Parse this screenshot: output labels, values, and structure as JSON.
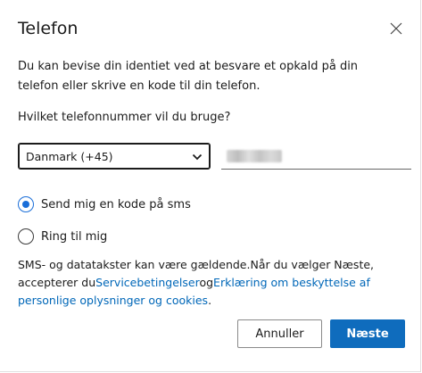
{
  "dialog": {
    "title": "Telefon",
    "close_icon": "close-icon",
    "description": "Du kan bevise din identiet ved at besvare et opkald på din telefon eller skrive en kode til din telefon.",
    "question": "Hvilket telefonnummer vil du bruge?",
    "country_select": {
      "selected": "Danmark (+45)"
    },
    "phone_input": {
      "value_obscured": true
    },
    "options": [
      {
        "label": "Send mig en kode på sms",
        "selected": true
      },
      {
        "label": "Ring til mig",
        "selected": false
      }
    ],
    "legal": {
      "text1": "SMS- og datatakster kan være gældende.Når du vælger Næste, accepterer du",
      "link1": "Servicebetingelser",
      "text2": "og",
      "link2": "Erklæring om beskyttelse af personlige oplysninger og cookies",
      "text3": "."
    },
    "buttons": {
      "cancel": "Annuller",
      "next": "Næste"
    },
    "colors": {
      "primary": "#0f6cbd",
      "link": "#0067b8",
      "radio": "#1a6ed8"
    }
  }
}
